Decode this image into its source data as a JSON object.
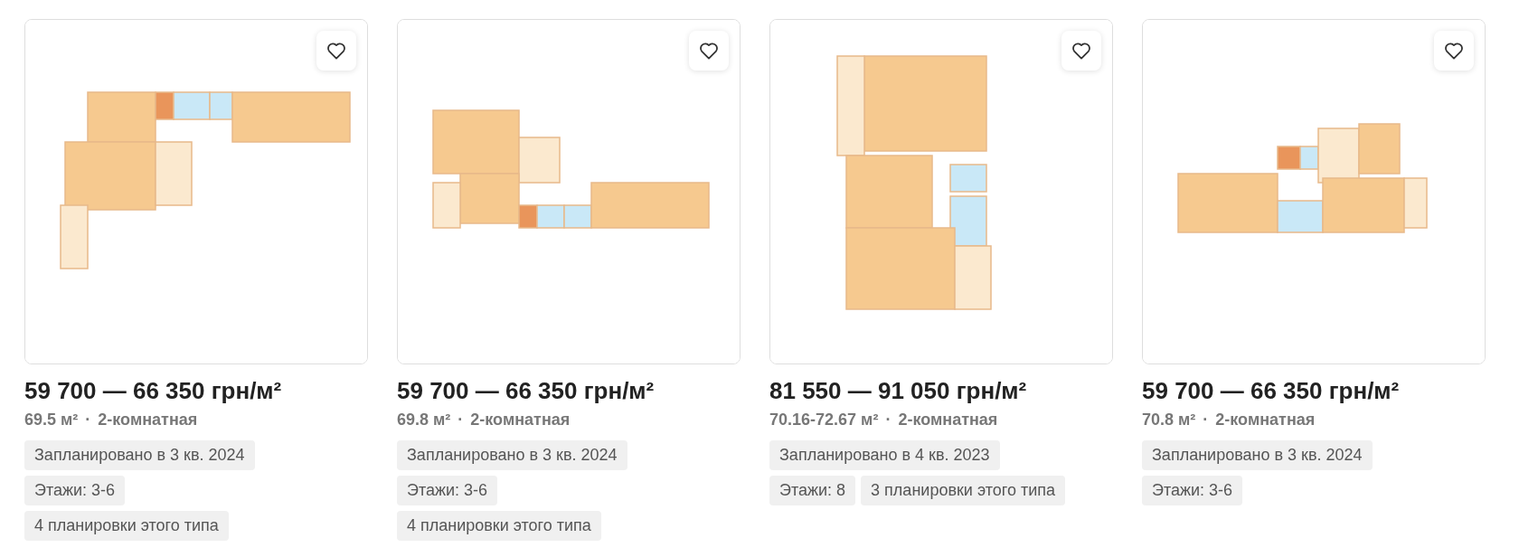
{
  "listings": [
    {
      "favorite": false,
      "price": "59 700 — 66 350 грн/м²",
      "area": "69.5 м²",
      "separator": "·",
      "rooms": "2-комнатная",
      "tag_rows": [
        [
          "Запланировано в 3 кв. 2024"
        ],
        [
          "Этажи: 3-6"
        ],
        [
          "4 планировки этого типа"
        ]
      ]
    },
    {
      "favorite": false,
      "price": "59 700 — 66 350 грн/м²",
      "area": "69.8 м²",
      "separator": "·",
      "rooms": "2-комнатная",
      "tag_rows": [
        [
          "Запланировано в 3 кв. 2024"
        ],
        [
          "Этажи: 3-6"
        ],
        [
          "4 планировки этого типа"
        ]
      ]
    },
    {
      "favorite": false,
      "price": "81 550 — 91 050 грн/м²",
      "area": "70.16-72.67 м²",
      "separator": "·",
      "rooms": "2-комнатная",
      "tag_rows": [
        [
          "Запланировано в 4 кв. 2023"
        ],
        [
          "Этажи: 8",
          "3 планировки этого типа"
        ]
      ]
    },
    {
      "favorite": false,
      "price": "59 700 — 66 350 грн/м²",
      "area": "70.8 м²",
      "separator": "·",
      "rooms": "2-комнатная",
      "tag_rows": [
        [
          "Запланировано в 3 кв. 2024"
        ],
        [
          "Этажи: 3-6"
        ]
      ]
    }
  ]
}
